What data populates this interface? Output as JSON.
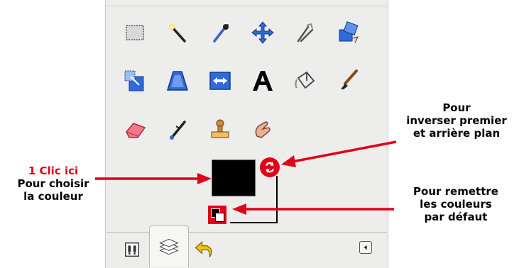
{
  "toolbox": {
    "tools": [
      {
        "icon": "rect-select-icon"
      },
      {
        "icon": "fuzzy-select-icon"
      },
      {
        "icon": "color-picker-icon"
      },
      {
        "icon": "move-icon"
      },
      {
        "icon": "crop-icon"
      },
      {
        "icon": "rotate-icon"
      },
      {
        "icon": "scale-icon"
      },
      {
        "icon": "perspective-icon"
      },
      {
        "icon": "flip-icon"
      },
      {
        "icon": "text-icon"
      },
      {
        "icon": "bucket-fill-icon"
      },
      {
        "icon": "paintbrush-icon"
      },
      {
        "icon": "eraser-icon"
      },
      {
        "icon": "ink-icon"
      },
      {
        "icon": "clone-icon"
      },
      {
        "icon": "smudge-icon"
      }
    ],
    "colors": {
      "foreground": "#000000",
      "background": "#ffffff",
      "accent": "#e0001a"
    }
  },
  "tabs": [
    {
      "icon": "device-status-icon"
    },
    {
      "icon": "layers-icon"
    },
    {
      "icon": "undo-history-icon"
    }
  ],
  "annotations": {
    "left_line1": "1 Clic ici",
    "left_line2": "Pour choisir",
    "left_line3": "la couleur",
    "swap_line1": "Pour",
    "swap_line2": "inverser premier",
    "swap_line3": "et arrière plan",
    "reset_line1": "Pour remettre",
    "reset_line2": "les couleurs",
    "reset_line3": "par défaut"
  }
}
